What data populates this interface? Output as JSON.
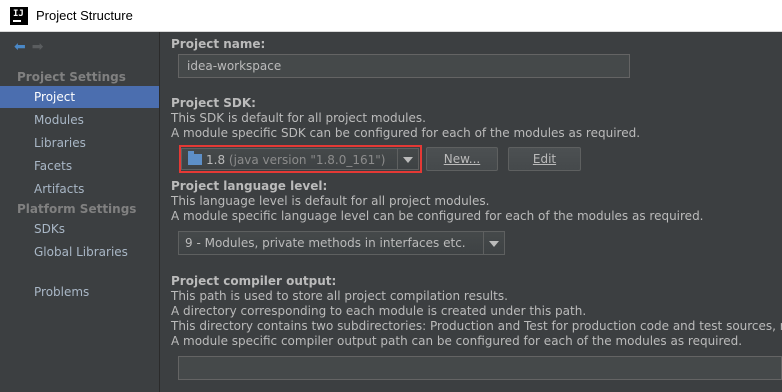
{
  "window": {
    "title": "Project Structure"
  },
  "sidebar": {
    "project_settings_header": "Project Settings",
    "platform_settings_header": "Platform Settings",
    "items": [
      {
        "label": "Project"
      },
      {
        "label": "Modules"
      },
      {
        "label": "Libraries"
      },
      {
        "label": "Facets"
      },
      {
        "label": "Artifacts"
      },
      {
        "label": "SDKs"
      },
      {
        "label": "Global Libraries"
      },
      {
        "label": "Problems"
      }
    ],
    "selected": "Project"
  },
  "project_name": {
    "label": "Project name:",
    "value": "idea-workspace"
  },
  "project_sdk": {
    "label": "Project SDK:",
    "desc1": "This SDK is default for all project modules.",
    "desc2": "A module specific SDK can be configured for each of the modules as required.",
    "selected_version": "1.8",
    "selected_detail": "(java version \"1.8.0_161\")",
    "new_button": "New...",
    "edit_button": "Edit"
  },
  "language_level": {
    "label": "Project language level:",
    "desc1": "This language level is default for all project modules.",
    "desc2": "A module specific language level can be configured for each of the modules as required.",
    "selected": "9 - Modules, private methods in interfaces etc."
  },
  "compiler_output": {
    "label": "Project compiler output:",
    "desc1": "This path is used to store all project compilation results.",
    "desc2": "A directory corresponding to each module is created under this path.",
    "desc3": "This directory contains two subdirectories: Production and Test for production code and test sources, respe",
    "desc4": "A module specific compiler output path can be configured for each of the modules as required.",
    "value": ""
  },
  "colors": {
    "background": "#3c3f41",
    "selection": "#4b6eaf",
    "highlight_border": "#e53935"
  }
}
